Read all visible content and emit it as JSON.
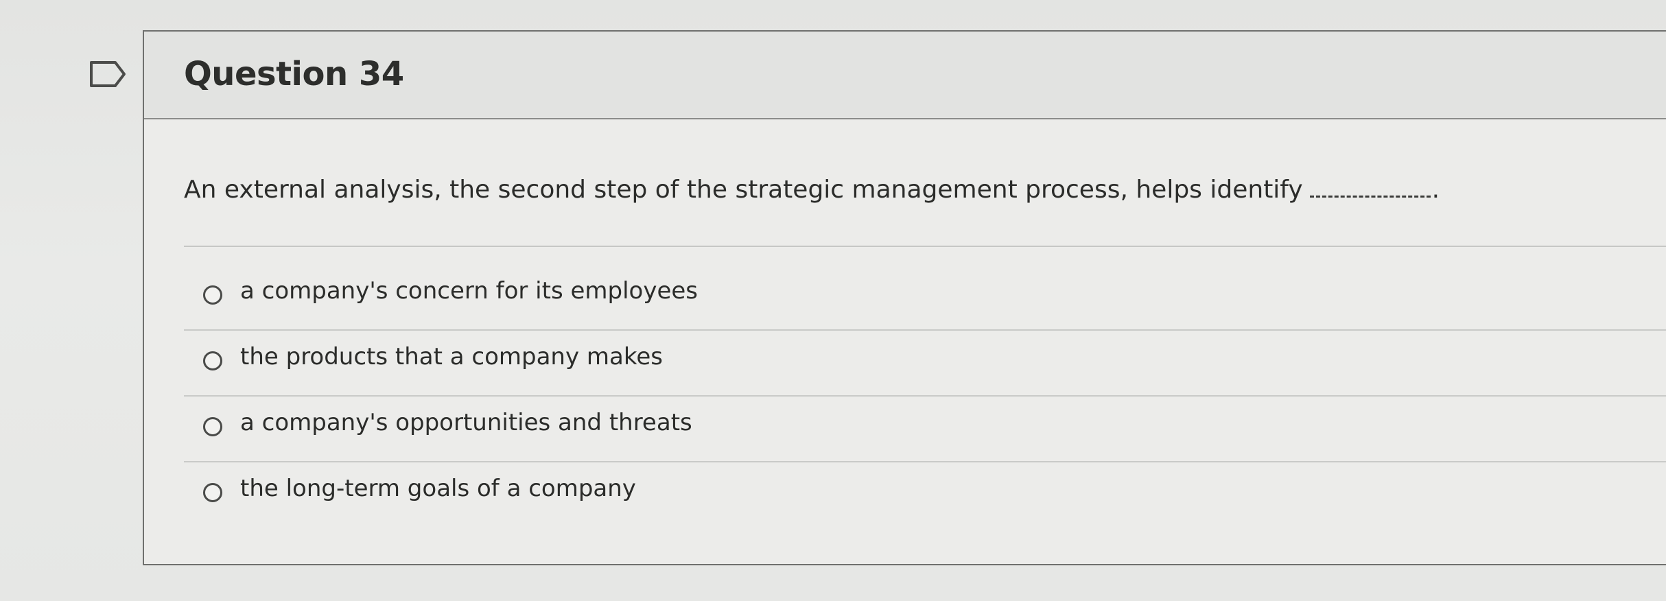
{
  "question": {
    "title": "Question 34",
    "text": "An external analysis, the second step of the strategic management process, helps identify",
    "blank_end": "."
  },
  "flag": {
    "icon": "flag-outline-icon"
  },
  "answers": [
    {
      "label": "a company's concern for its employees"
    },
    {
      "label": "the products that a company makes"
    },
    {
      "label": "a company's opportunities and threats"
    },
    {
      "label": "the long-term goals of a company"
    }
  ],
  "colors": {
    "text": "#2b2c2a",
    "border": "#6f706e",
    "background": "#e7e8e6"
  }
}
